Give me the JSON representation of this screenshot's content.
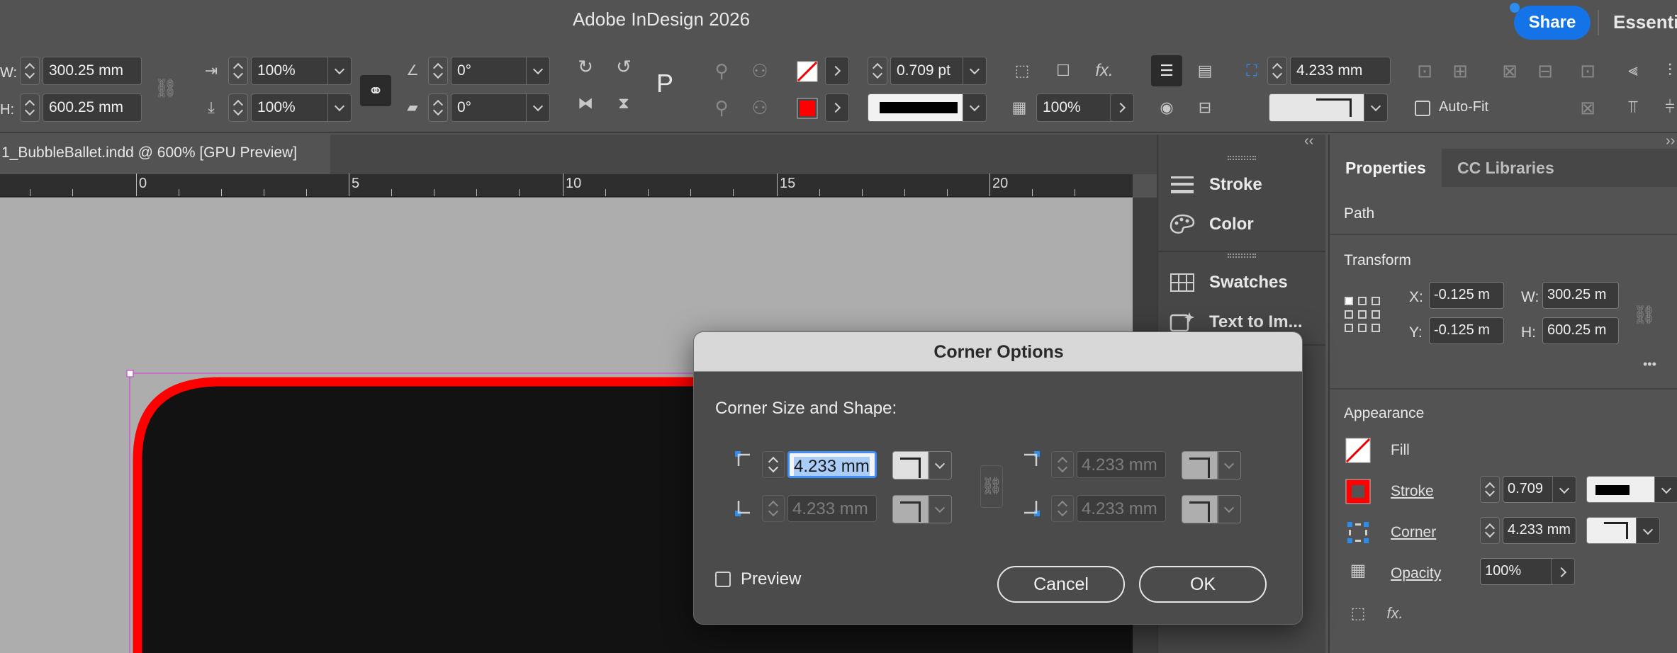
{
  "app": {
    "title": "Adobe InDesign 2026"
  },
  "header": {
    "share_label": "Share",
    "workspace_label": "Essentials"
  },
  "control": {
    "w_label": "W:",
    "w_value": "300.25 mm",
    "h_label": "H:",
    "h_value": "600.25 mm",
    "scale_x": "100%",
    "scale_y": "100%",
    "rotate": "0°",
    "shear": "0°",
    "stroke_weight": "0.709 pt",
    "corner_size": "4.233 mm",
    "opacity": "100%",
    "autofit_label": "Auto-Fit",
    "fill_color": "#ff0000"
  },
  "document": {
    "tab_label": "1_BubbleBallet.indd @ 600% [GPU Preview]"
  },
  "ruler": {
    "ticks": [
      "0",
      "5",
      "10",
      "15",
      "20"
    ]
  },
  "dock": {
    "items": [
      {
        "label": "Stroke",
        "icon": "stroke-lines-icon"
      },
      {
        "label": "Color",
        "icon": "palette-icon"
      },
      {
        "label": "Swatches",
        "icon": "swatches-grid-icon"
      },
      {
        "label": "Text to Im...",
        "icon": "text-to-image-icon"
      }
    ]
  },
  "properties": {
    "tabs": [
      "Properties",
      "CC Libraries"
    ],
    "object_type": "Path",
    "transform": {
      "title": "Transform",
      "x_label": "X:",
      "x_value": "-0.125 m",
      "y_label": "Y:",
      "y_value": "-0.125 m",
      "w_label": "W:",
      "w_value": "300.25 m",
      "h_label": "H:",
      "h_value": "600.25 m"
    },
    "appearance": {
      "title": "Appearance",
      "fill_label": "Fill",
      "stroke_label": "Stroke",
      "stroke_value": "0.709",
      "corner_label": "Corner",
      "corner_value": "4.233 mm",
      "opacity_label": "Opacity",
      "opacity_value": "100%"
    },
    "more_label": "•••"
  },
  "dialog": {
    "title": "Corner Options",
    "subtitle": "Corner Size and Shape:",
    "top_left": "4.233 mm",
    "bottom_left": "4.233 mm",
    "top_right": "4.233 mm",
    "bottom_right": "4.233 mm",
    "preview_label": "Preview",
    "cancel_label": "Cancel",
    "ok_label": "OK"
  }
}
